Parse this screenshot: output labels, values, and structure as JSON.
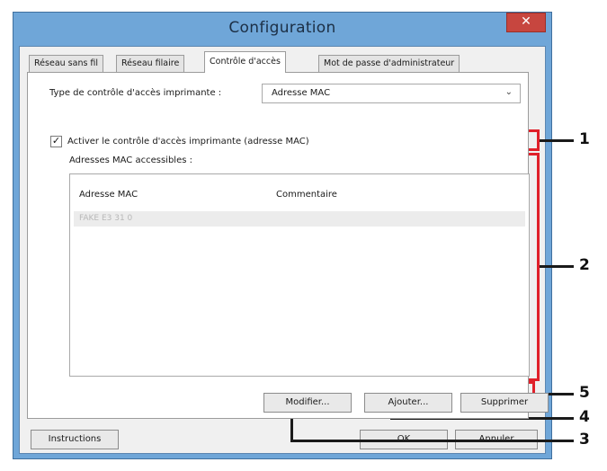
{
  "window": {
    "title": "Configuration",
    "close_icon": "close-icon"
  },
  "tabs": [
    {
      "label": "Réseau sans fil"
    },
    {
      "label": "Réseau filaire"
    },
    {
      "label": "Contrôle d'accès"
    },
    {
      "label": "Mot de passe d'administrateur"
    }
  ],
  "panel": {
    "access_type_label": "Type de contrôle d'accès imprimante :",
    "access_type_value": "Adresse MAC",
    "checkbox_checked": true,
    "checkbox_label": "Activer le contrôle d'accès imprimante (adresse MAC)",
    "accessible_label": "Adresses MAC accessibles :",
    "columns": [
      "Adresse MAC",
      "Commentaire"
    ],
    "rows": [
      {
        "mac": "FAKE E3 31 0",
        "comment": ""
      }
    ]
  },
  "buttons": {
    "modify": "Modifier...",
    "add": "Ajouter...",
    "delete": "Supprimer",
    "instructions": "Instructions",
    "ok": "OK",
    "cancel": "Annuler"
  },
  "callouts": {
    "c1": "1",
    "c2": "2",
    "c3": "3",
    "c4": "4",
    "c5": "5"
  },
  "colors": {
    "highlight": "#e0202a",
    "titlebar": "#6fa6d8",
    "close_button": "#c7463f"
  }
}
